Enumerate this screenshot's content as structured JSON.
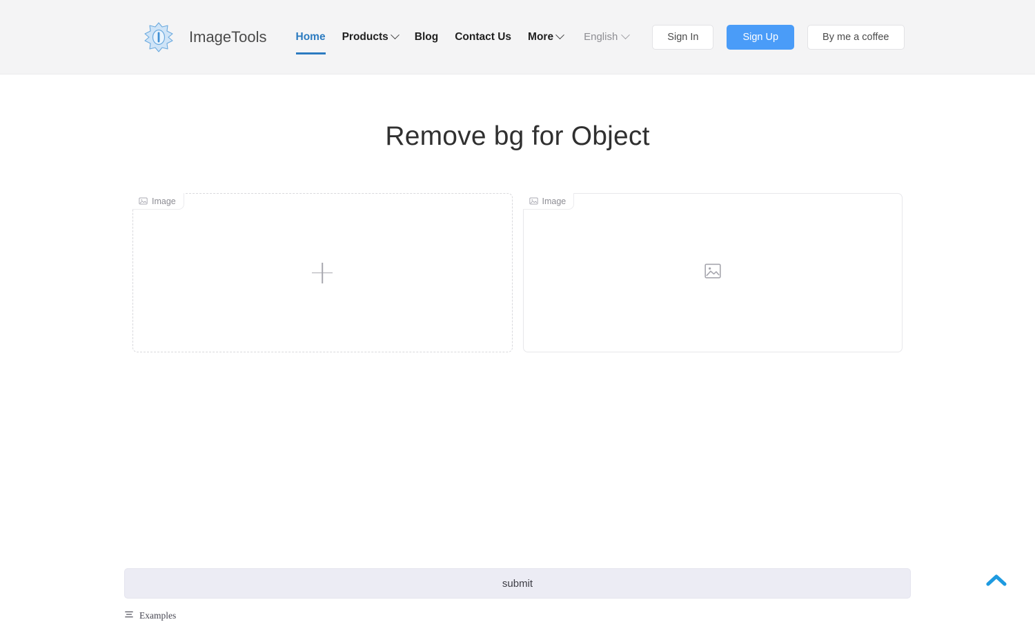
{
  "brand": {
    "name": "ImageTools",
    "logo_icon": "badge-star-i-logo"
  },
  "nav": {
    "items": [
      {
        "label": "Home",
        "active": true,
        "has_dropdown": false
      },
      {
        "label": "Products",
        "active": false,
        "has_dropdown": true
      },
      {
        "label": "Blog",
        "active": false,
        "has_dropdown": false
      },
      {
        "label": "Contact Us",
        "active": false,
        "has_dropdown": false
      },
      {
        "label": "More",
        "active": false,
        "has_dropdown": true
      }
    ],
    "active_color": "#2c7bc0"
  },
  "language": {
    "label": "English",
    "icon": "chevron-down-icon"
  },
  "header_buttons": {
    "sign_in": "Sign In",
    "sign_up": "Sign Up",
    "coffee": "By me a coffee",
    "primary_color": "#4a9cf8"
  },
  "main": {
    "title": "Remove bg for Object",
    "upload_panel": {
      "chip_label": "Image",
      "chip_icon": "image-icon",
      "placeholder_icon": "plus-icon"
    },
    "result_panel": {
      "chip_label": "Image",
      "chip_icon": "image-icon",
      "placeholder_icon": "image-placeholder-icon"
    }
  },
  "footer": {
    "submit_label": "submit",
    "examples_label": "Examples",
    "examples_icon": "list-icon",
    "scroll_top_icon": "chevron-up-icon",
    "scroll_top_color": "#1e9ae0"
  }
}
